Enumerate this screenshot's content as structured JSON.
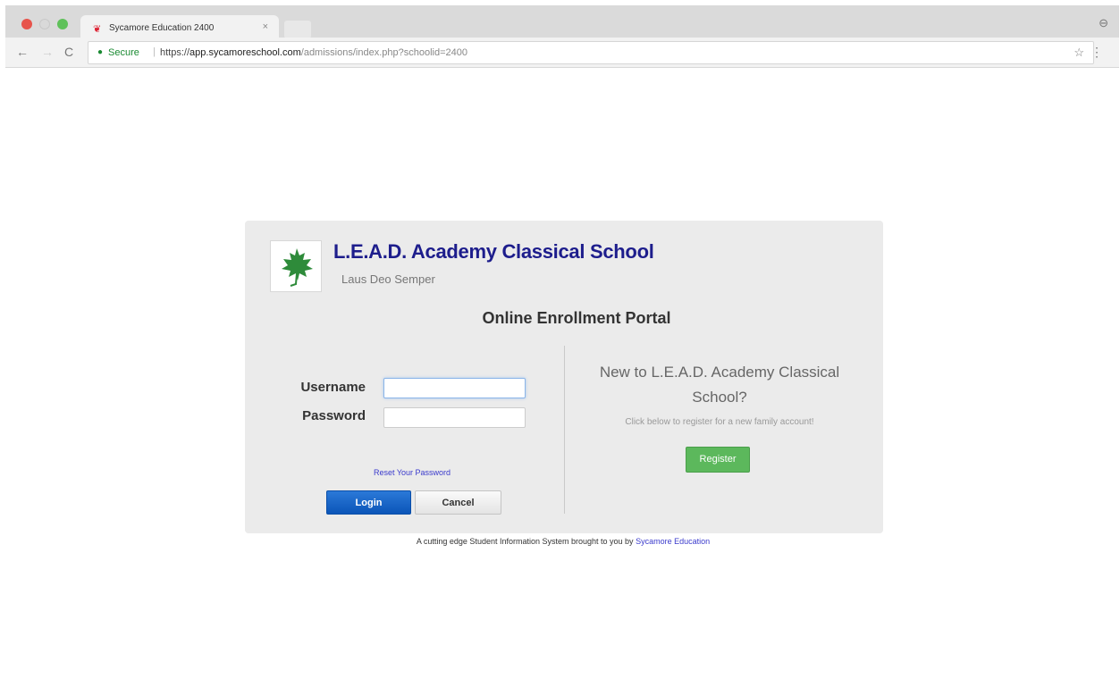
{
  "browser": {
    "tab_title": "Sycamore Education 2400",
    "tab_close": "×",
    "secure_label": "Secure",
    "url_scheme": "https://",
    "url_host": "app.sycamoreschool.com",
    "url_path": "/admissions/index.php?schoolid=2400"
  },
  "school": {
    "name": "L.E.A.D. Academy Classical School",
    "motto": "Laus Deo Semper",
    "portal_title": "Online Enrollment Portal"
  },
  "login": {
    "username_label": "Username",
    "password_label": "Password",
    "username_value": "",
    "password_value": "",
    "reset_link": "Reset Your Password",
    "login_button": "Login",
    "cancel_button": "Cancel"
  },
  "register": {
    "heading": "New to L.E.A.D. Academy Classical School?",
    "subtext": "Click below to register for a new family account!",
    "button": "Register"
  },
  "footer": {
    "text": "A cutting edge Student Information System brought to you by",
    "link": "Sycamore Education"
  },
  "colors": {
    "school_name": "#1d1d8c",
    "login_button": "#0b55b8",
    "register_button": "#5cb85c",
    "panel_bg": "#ebebeb"
  }
}
